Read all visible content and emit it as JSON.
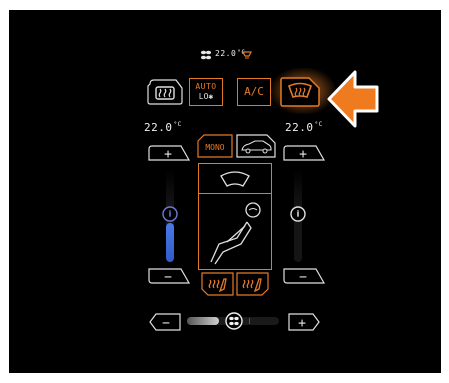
{
  "status_bar": {
    "temp": "22.0",
    "unit": "°C",
    "fan_icon": "fan-icon",
    "heat_icon": "seat-heat-icon"
  },
  "top_buttons": {
    "rear_defrost": {
      "icon": "rear-defrost-icon"
    },
    "auto": {
      "line1": "AUTO",
      "line2": "LO"
    },
    "ac": {
      "label": "A/C"
    },
    "front_defrost": {
      "icon": "front-defrost-icon",
      "active": true
    }
  },
  "left_zone": {
    "temp": "22.0",
    "unit": "°C",
    "plus": "+",
    "minus": "−",
    "level": 0.42,
    "color": "#3f6fd8"
  },
  "right_zone": {
    "temp": "22.0",
    "unit": "°C",
    "plus": "+",
    "minus": "−",
    "level": 0.0
  },
  "center": {
    "mono_label": "MONO",
    "sync_icon": "car-sync-icon"
  },
  "airflow": {
    "windshield_icon": "windshield-icon",
    "seat_icon": "seat-occupant-icon"
  },
  "seat_heat": {
    "left_icon": "seat-heat-left-icon",
    "right_icon": "seat-heat-right-icon"
  },
  "fan": {
    "minus": "−",
    "plus": "+",
    "level": 0.35,
    "icon": "fan-icon"
  },
  "hint_arrow": {
    "icon": "pointer-arrow-icon"
  },
  "colors": {
    "accent": "#e37a26",
    "outline": "#dcdcdc",
    "panel": "#000000",
    "active_blue": "#3f6fd8"
  }
}
